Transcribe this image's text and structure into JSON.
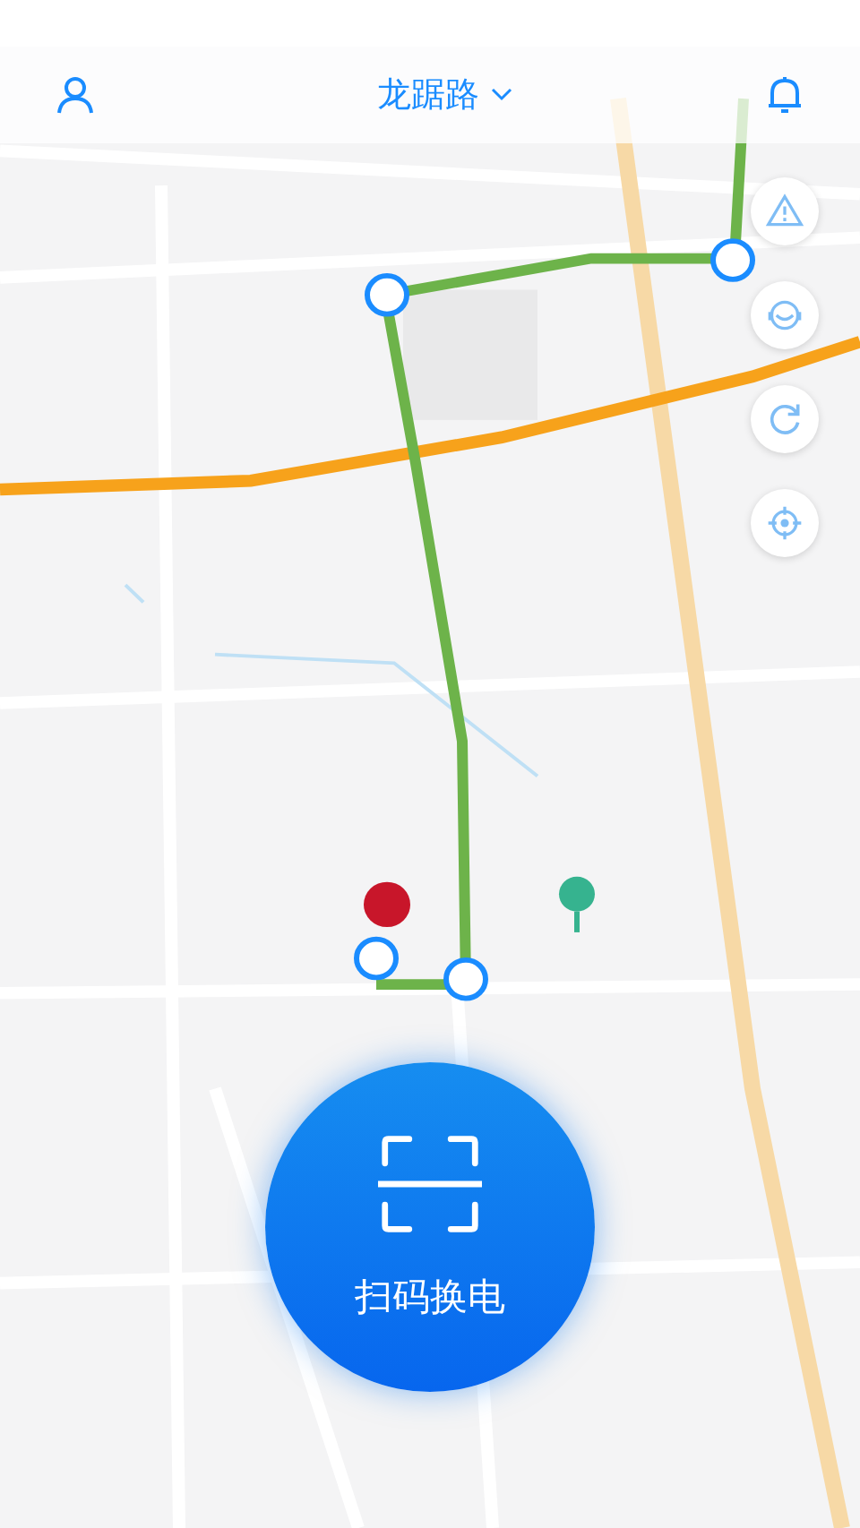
{
  "top_bar": {
    "location": "龙踞路"
  },
  "map_controls": [
    {
      "kind": "warning"
    },
    {
      "kind": "service"
    },
    {
      "kind": "refresh"
    },
    {
      "kind": "locate"
    }
  ],
  "scan_button": {
    "label": "扫码换电"
  }
}
